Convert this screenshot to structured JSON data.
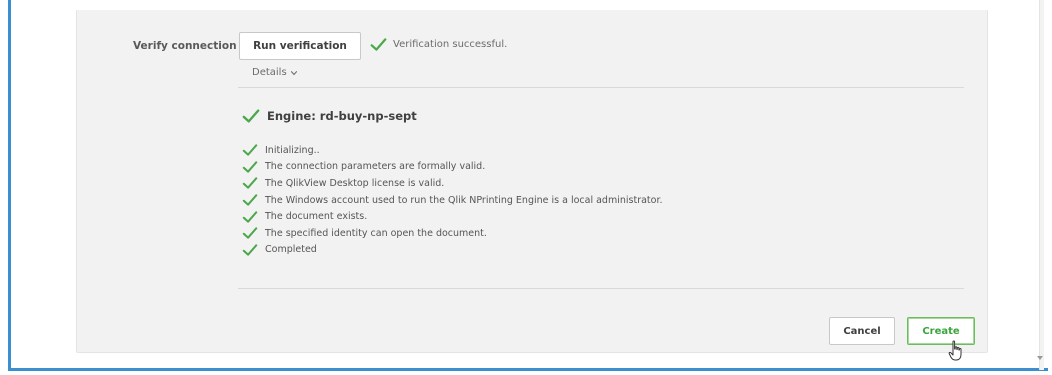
{
  "verify": {
    "label": "Verify connection",
    "run_button": "Run verification",
    "status": "Verification successful.",
    "details_toggle": "Details"
  },
  "engine": {
    "title": "Engine: rd-buy-np-sept"
  },
  "steps": [
    "Initializing..",
    "The connection parameters are formally valid.",
    "The QlikView Desktop license is valid.",
    "The Windows account used to run the Qlik NPrinting Engine is a local administrator.",
    "The document exists.",
    "The specified identity can open the document.",
    "Completed"
  ],
  "footer": {
    "cancel_label": "Cancel",
    "create_label": "Create"
  },
  "colors": {
    "success": "#4aa84a",
    "accent_border": "#3b8fd0"
  },
  "icons": {
    "check": "check-icon",
    "chevron": "chevron-down-icon",
    "cursor": "mouse-pointer-icon"
  }
}
